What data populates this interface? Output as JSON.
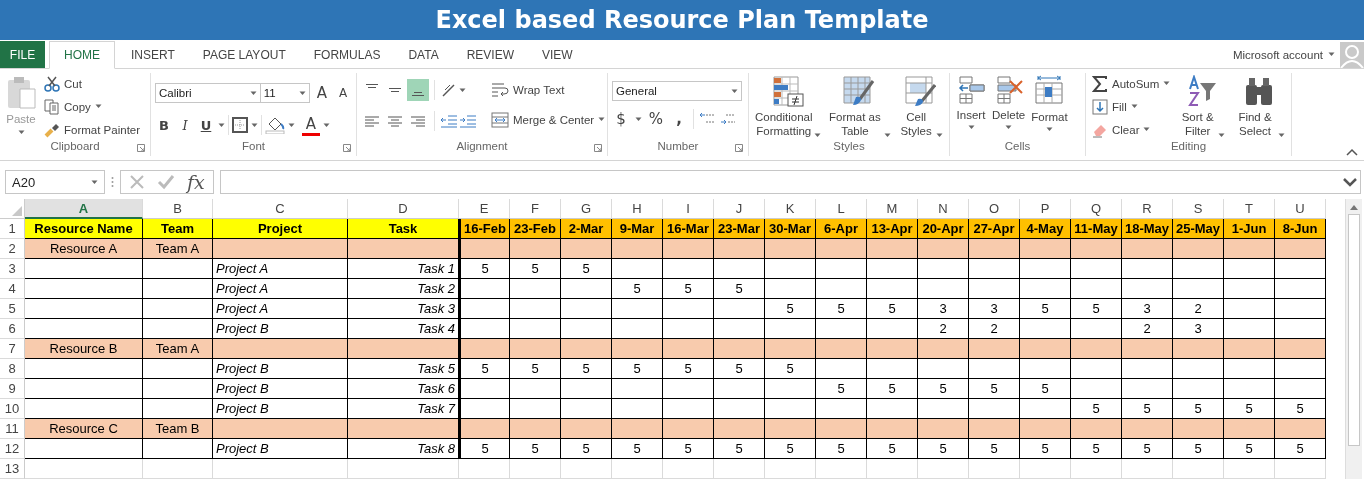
{
  "window": {
    "title": "Excel based Resource Plan Template"
  },
  "ribbon_tabs": [
    {
      "label": "FILE",
      "kind": "file"
    },
    {
      "label": "HOME",
      "kind": "tab",
      "selected": true
    },
    {
      "label": "INSERT",
      "kind": "tab",
      "selected": false
    },
    {
      "label": "PAGE LAYOUT",
      "kind": "tab",
      "selected": false
    },
    {
      "label": "FORMULAS",
      "kind": "tab",
      "selected": false
    },
    {
      "label": "DATA",
      "kind": "tab",
      "selected": false
    },
    {
      "label": "REVIEW",
      "kind": "tab",
      "selected": false
    },
    {
      "label": "VIEW",
      "kind": "tab",
      "selected": false
    }
  ],
  "account": {
    "label": "Microsoft account"
  },
  "clipboard": {
    "label": "Clipboard",
    "paste": {
      "label": "Paste",
      "disabled": true
    },
    "cut": "Cut",
    "copy": "Copy",
    "format_painter": "Format Painter"
  },
  "font": {
    "label": "Font",
    "font_name": "Calibri",
    "font_size": "11",
    "grow": "A",
    "shrink": "A",
    "bold": "B",
    "italic": "I",
    "underline": "U",
    "font_color": "A"
  },
  "alignment": {
    "label": "Alignment",
    "vertical_align": [
      {
        "selected": false
      },
      {
        "selected": false
      },
      {
        "selected": true
      }
    ],
    "wrap_text": "Wrap Text",
    "merge_center": "Merge & Center"
  },
  "number": {
    "label": "Number",
    "format": "General",
    "currency": "$",
    "percent": "%",
    "comma": ","
  },
  "styles": {
    "label": "Styles",
    "buttons": [
      "Conditional Formatting",
      "Format as Table",
      "Cell Styles"
    ]
  },
  "cells": {
    "label": "Cells",
    "buttons": [
      "Insert",
      "Delete",
      "Format"
    ]
  },
  "editing": {
    "label": "Editing",
    "autosum": "AutoSum",
    "fill": "Fill",
    "clear": "Clear",
    "sort_filter": "Sort & Filter",
    "find_select": "Find & Select"
  },
  "formula_bar": {
    "name_box": "A20",
    "fx": "fx"
  },
  "sheet": {
    "columns": [
      {
        "label": "A",
        "selected": true
      },
      {
        "label": "B",
        "selected": false
      },
      {
        "label": "C",
        "selected": false
      },
      {
        "label": "D",
        "selected": false
      },
      {
        "label": "E",
        "selected": false
      },
      {
        "label": "F",
        "selected": false
      },
      {
        "label": "G",
        "selected": false
      },
      {
        "label": "H",
        "selected": false
      },
      {
        "label": "I",
        "selected": false
      },
      {
        "label": "J",
        "selected": false
      },
      {
        "label": "K",
        "selected": false
      },
      {
        "label": "L",
        "selected": false
      },
      {
        "label": "M",
        "selected": false
      },
      {
        "label": "N",
        "selected": false
      },
      {
        "label": "O",
        "selected": false
      },
      {
        "label": "P",
        "selected": false
      },
      {
        "label": "Q",
        "selected": false
      },
      {
        "label": "R",
        "selected": false
      },
      {
        "label": "S",
        "selected": false
      },
      {
        "label": "T",
        "selected": false
      },
      {
        "label": "U",
        "selected": false
      }
    ],
    "rows": [
      {
        "number": "1",
        "kind": "header",
        "cells": {
          "A": "Resource Name",
          "B": "Team",
          "C": "Project",
          "D": "Task",
          "E": "16-Feb",
          "F": "23-Feb",
          "G": "2-Mar",
          "H": "9-Mar",
          "I": "16-Mar",
          "J": "23-Mar",
          "K": "30-Mar",
          "L": "6-Apr",
          "M": "13-Apr",
          "N": "20-Apr",
          "O": "27-Apr",
          "P": "4-May",
          "Q": "11-May",
          "R": "18-May",
          "S": "25-May",
          "T": "1-Jun",
          "U": "8-Jun"
        }
      },
      {
        "number": "2",
        "kind": "resource",
        "cells": {
          "A": "Resource A",
          "B": "Team A"
        }
      },
      {
        "number": "3",
        "kind": "task",
        "cells": {
          "C": "Project A",
          "D": "Task 1",
          "E": "5",
          "F": "5",
          "G": "5"
        }
      },
      {
        "number": "4",
        "kind": "task",
        "cells": {
          "C": "Project A",
          "D": "Task 2",
          "H": "5",
          "I": "5",
          "J": "5"
        }
      },
      {
        "number": "5",
        "kind": "task",
        "cells": {
          "C": "Project A",
          "D": "Task 3",
          "K": "5",
          "L": "5",
          "M": "5",
          "N": "3",
          "O": "3",
          "P": "5",
          "Q": "5",
          "R": "3",
          "S": "2"
        }
      },
      {
        "number": "6",
        "kind": "task",
        "cells": {
          "C": "Project B",
          "D": "Task 4",
          "N": "2",
          "O": "2",
          "R": "2",
          "S": "3"
        }
      },
      {
        "number": "7",
        "kind": "resource",
        "cells": {
          "A": "Resource B",
          "B": "Team A"
        }
      },
      {
        "number": "8",
        "kind": "task",
        "cells": {
          "C": "Project B",
          "D": "Task 5",
          "E": "5",
          "F": "5",
          "G": "5",
          "H": "5",
          "I": "5",
          "J": "5",
          "K": "5"
        }
      },
      {
        "number": "9",
        "kind": "task",
        "cells": {
          "C": "Project B",
          "D": "Task 6",
          "L": "5",
          "M": "5",
          "N": "5",
          "O": "5",
          "P": "5"
        }
      },
      {
        "number": "10",
        "kind": "task",
        "cells": {
          "C": "Project B",
          "D": "Task 7",
          "Q": "5",
          "R": "5",
          "S": "5",
          "T": "5",
          "U": "5"
        }
      },
      {
        "number": "11",
        "kind": "resource",
        "cells": {
          "A": "Resource C",
          "B": "Team B"
        }
      },
      {
        "number": "12",
        "kind": "task",
        "cells": {
          "C": "Project B",
          "D": "Task 8",
          "E": "5",
          "F": "5",
          "G": "5",
          "H": "5",
          "I": "5",
          "J": "5",
          "K": "5",
          "L": "5",
          "M": "5",
          "N": "5",
          "O": "5",
          "P": "5",
          "Q": "5",
          "R": "5",
          "S": "5",
          "T": "5",
          "U": "5"
        }
      },
      {
        "number": "13",
        "kind": "blank",
        "cells": {}
      }
    ]
  }
}
